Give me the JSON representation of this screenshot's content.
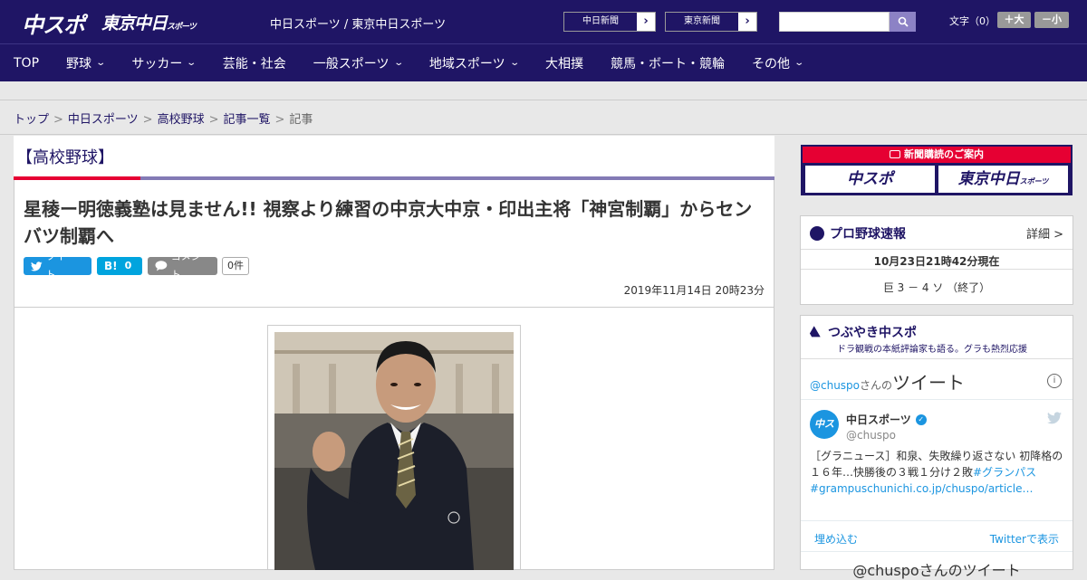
{
  "header": {
    "logo_main": "中スポ",
    "logo_tokyo": "東京中日",
    "logo_tokyo_sub": "スポーツ",
    "site_name": "中日スポーツ / 東京中日スポーツ",
    "link_chunichi": "中日新聞",
    "link_tokyo": "東京新聞",
    "font_label": "文字（0）",
    "font_plus": "＋大",
    "font_minus": "－小",
    "search_placeholder": ""
  },
  "nav": [
    {
      "label": "TOP",
      "has_menu": false
    },
    {
      "label": "野球",
      "has_menu": true
    },
    {
      "label": "サッカー",
      "has_menu": true
    },
    {
      "label": "芸能・社会",
      "has_menu": false
    },
    {
      "label": "一般スポーツ",
      "has_menu": true
    },
    {
      "label": "地域スポーツ",
      "has_menu": true
    },
    {
      "label": "大相撲",
      "has_menu": false
    },
    {
      "label": "競馬・ボート・競輪",
      "has_menu": false
    },
    {
      "label": "その他",
      "has_menu": true
    }
  ],
  "breadcrumb": [
    "トップ",
    "中日スポーツ",
    "高校野球",
    "記事一覧",
    "記事"
  ],
  "article": {
    "category": "【高校野球】",
    "headline": "星稜ー明徳義塾は見ません!! 視察より練習の中京大中京・印出主将「神宮制覇」からセンバツ制覇へ",
    "tweet_label": "ツイート",
    "hatena_label": "B!",
    "hatena_count": "0",
    "comment_label": "コメント",
    "comment_count": "0件",
    "date": "2019年11月14日 20時23分"
  },
  "sidebar": {
    "ad_title": "新聞購読のご案内",
    "ad_logo_1": "中スポ",
    "ad_logo_2": "東京中日",
    "ad_logo_2_sub": "スポーツ",
    "baseball_title": "プロ野球速報",
    "baseball_detail": "詳細 >",
    "baseball_time": "10月23日21時42分現在",
    "baseball_score": "巨 3 － 4 ソ （終了）",
    "tweets_title": "つぶやき中スポ",
    "tweets_subtitle": "ドラ観戦の本紙評論家も語る。グラも熱烈応援",
    "timeline_handle": "@chuspo",
    "timeline_san": "さんの",
    "timeline_tweet": "ツイート",
    "tweet_name": "中日スポーツ",
    "tweet_handle": "@chuspo",
    "tweet_body": "［グラニュース］和泉、失敗繰り返さない 初降格の１６年…快勝後の３戦１分け２敗",
    "tweet_tag": "#グランパス",
    "tweet_link": "#grampuschunichi.co.jp/chuspo/article…",
    "embed_label": "埋め込む",
    "view_on_twitter": "Twitterで表示",
    "timeline_footer": "@chuspoさんのツイート"
  },
  "colors": {
    "brand_navy": "#1f1565",
    "accent_red": "#e60033",
    "twitter_blue": "#1b95e0"
  }
}
